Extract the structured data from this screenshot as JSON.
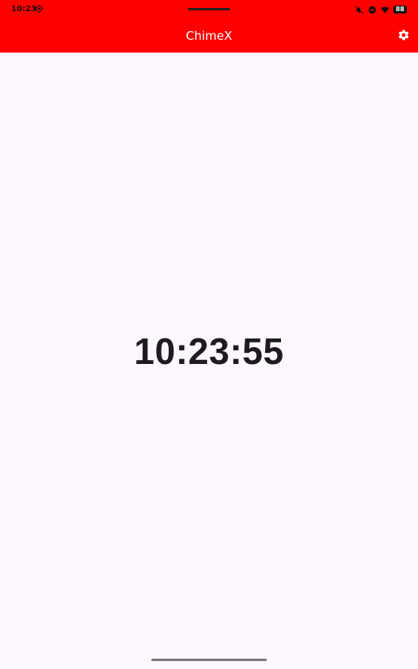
{
  "status_bar": {
    "time": "10:23",
    "battery": "88",
    "icons": [
      "location-target-icon",
      "mute-icon",
      "dnd-icon",
      "wifi-icon",
      "battery-icon"
    ]
  },
  "app_bar": {
    "title": "ChimeX",
    "color": "#ff0000",
    "settings_icon": "gear-icon"
  },
  "main": {
    "clock_time": "10:23:55"
  }
}
